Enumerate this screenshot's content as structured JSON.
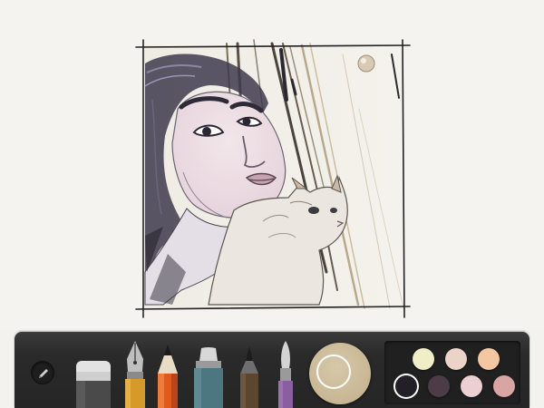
{
  "app": {
    "canvas": {
      "artwork_description_icon": "portrait-sketch-of-woman-with-cat"
    },
    "toolbar": {
      "edit_icon": "pencil-icon",
      "tools": [
        {
          "id": "eraser",
          "icon": "eraser-icon"
        },
        {
          "id": "fountain-pen",
          "icon": "fountain-pen-icon",
          "color": "#d69a2b"
        },
        {
          "id": "pencil",
          "icon": "pencil-tool-icon",
          "color": "#e05a1e"
        },
        {
          "id": "marker",
          "icon": "marker-icon",
          "color": "#4d7780"
        },
        {
          "id": "pen",
          "icon": "pen-icon",
          "color": "#5c4630"
        },
        {
          "id": "brush",
          "icon": "brush-icon",
          "color": "#8a5fa0"
        }
      ],
      "mixer": {
        "icon": "color-mixer-icon",
        "current_color": "#cdbc9a"
      },
      "palette": [
        {
          "color": "#efeec6"
        },
        {
          "color": "#ecd3c8"
        },
        {
          "color": "#f4c7a3"
        },
        {
          "color": "#222026",
          "selected": true
        },
        {
          "color": "#4b3c48"
        },
        {
          "color": "#eccfd2"
        },
        {
          "color": "#d9a5a4"
        }
      ]
    }
  }
}
